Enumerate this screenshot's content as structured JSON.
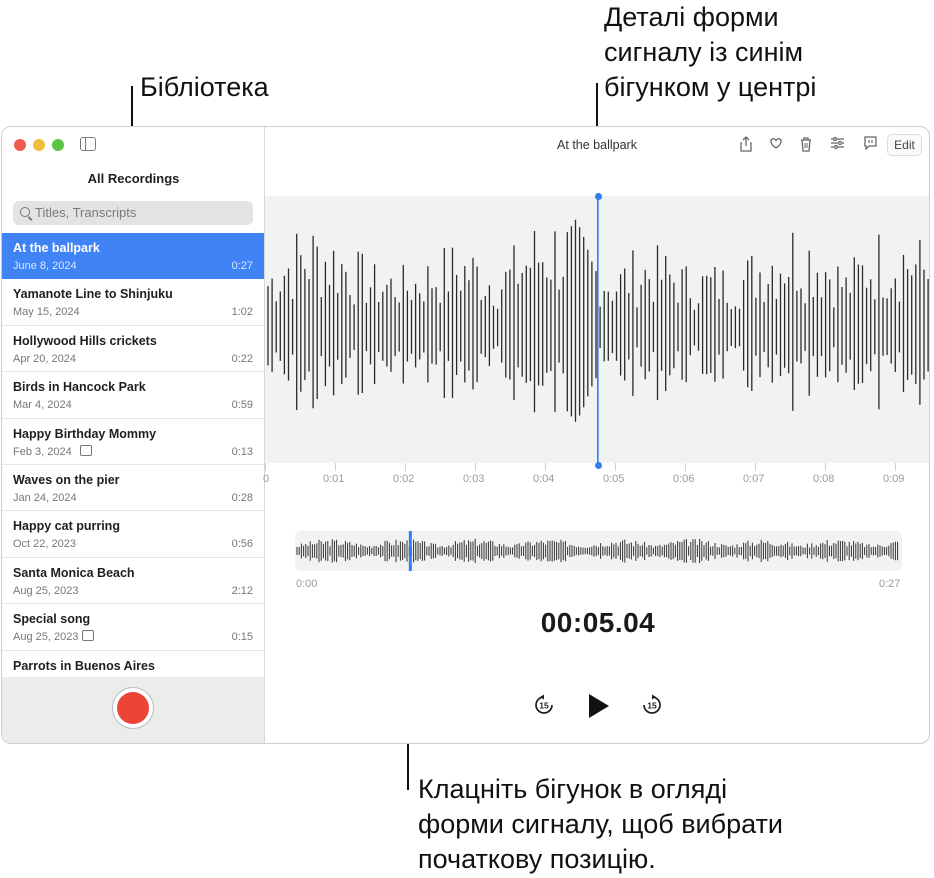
{
  "callouts": {
    "library": "Бібліотека",
    "waveform_detail": "Деталі форми\nсигналу із синім\nбігунком у центрі",
    "overview_hint": "Клацніть бігунок в огляді\nформи сигналу, щоб вибрати\nпочаткову позицію."
  },
  "sidebar": {
    "title": "All Recordings",
    "search_placeholder": "Titles, Transcripts",
    "recordings": [
      {
        "title": "At the ballpark",
        "date": "June 8, 2024",
        "duration": "0:27",
        "selected": true,
        "transcript": false
      },
      {
        "title": "Yamanote Line to Shinjuku",
        "date": "May 15, 2024",
        "duration": "1:02",
        "selected": false,
        "transcript": false
      },
      {
        "title": "Hollywood Hills crickets",
        "date": "Apr 20, 2024",
        "duration": "0:22",
        "selected": false,
        "transcript": false
      },
      {
        "title": "Birds in Hancock Park",
        "date": "Mar 4, 2024",
        "duration": "0:59",
        "selected": false,
        "transcript": false
      },
      {
        "title": "Happy Birthday Mommy",
        "date": "Feb 3, 2024",
        "duration": "0:13",
        "selected": false,
        "transcript": true
      },
      {
        "title": "Waves on the pier",
        "date": "Jan 24, 2024",
        "duration": "0:28",
        "selected": false,
        "transcript": false
      },
      {
        "title": "Happy cat purring",
        "date": "Oct 22, 2023",
        "duration": "0:56",
        "selected": false,
        "transcript": false
      },
      {
        "title": "Santa Monica Beach",
        "date": "Aug 25, 2023",
        "duration": "2:12",
        "selected": false,
        "transcript": false
      },
      {
        "title": "Special song",
        "date": "Aug 25, 2023",
        "duration": "0:15",
        "selected": false,
        "transcript": true
      },
      {
        "title": "Parrots in Buenos Aires",
        "date": "",
        "duration": "",
        "selected": false,
        "transcript": false
      }
    ]
  },
  "toolbar": {
    "window_title": "At the ballpark",
    "edit_label": "Edit",
    "icons": [
      "share-icon",
      "heart-icon",
      "trash-icon",
      "sliders-icon",
      "transcript-icon"
    ]
  },
  "waveform": {
    "ruler_ticks": [
      "0",
      "0:01",
      "0:02",
      "0:03",
      "0:04",
      "0:05",
      "0:06",
      "0:07",
      "0:08",
      "0:09"
    ],
    "playhead_seconds": 5.04
  },
  "overview": {
    "start_label": "0:00",
    "end_label": "0:27",
    "position_fraction": 0.19
  },
  "playback": {
    "time": "00:05.04",
    "skip_back_label": "15",
    "skip_forward_label": "15"
  },
  "colors": {
    "accent": "#3f83f5",
    "record": "#ec4437",
    "playhead": "#2f7ff2"
  }
}
